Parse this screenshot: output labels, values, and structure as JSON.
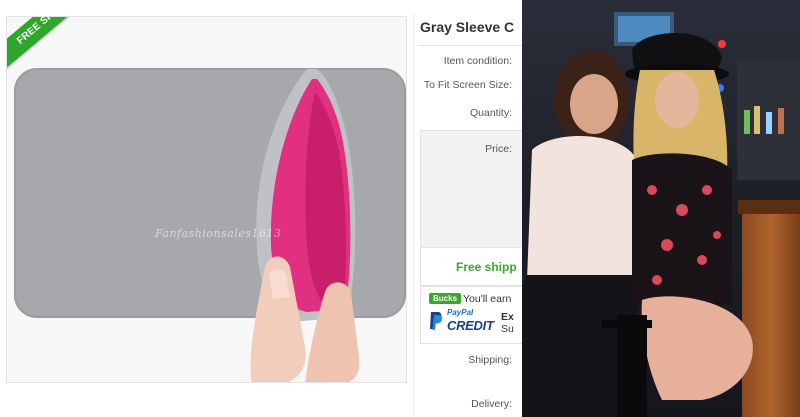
{
  "listing": {
    "ribbon_text": "FREE SHIPPING",
    "watermark": "Fanfashionsales1613",
    "title": "Gray Sleeve C",
    "specs": {
      "condition_label": "Item condition:",
      "screen_label": "To Fit Screen Size:",
      "quantity_label": "Quantity:",
      "price_label": "Price:",
      "shipping_label": "Shipping:",
      "delivery_label": "Delivery:"
    },
    "free_shipping": "Free shipp",
    "bucks": {
      "badge": "Bucks",
      "text": "You'll earn"
    },
    "paypal": {
      "logo_top": "PayPal",
      "logo_credit": "CREDIT",
      "line1": "Ex",
      "line2": "Su"
    },
    "colors": {
      "free_green": "#3aa828",
      "paypal_blue": "#1a3e8e",
      "sleeve_gray": "#a7a9ad",
      "lining_pink": "#e0307f"
    }
  },
  "photo_right": {
    "description_icon": "bar-photo-image"
  }
}
